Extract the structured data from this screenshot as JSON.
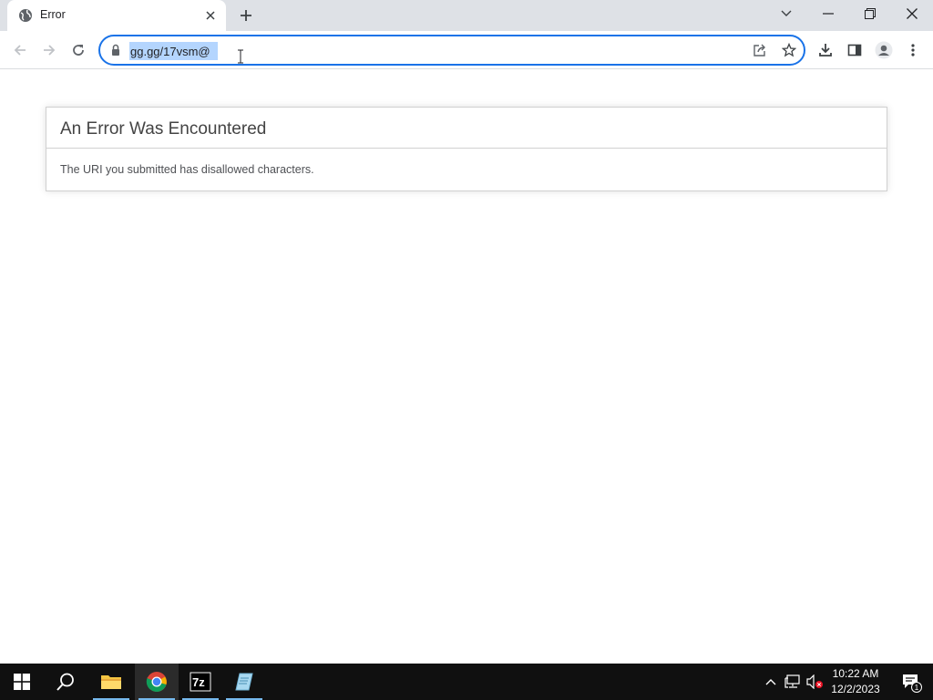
{
  "browser": {
    "tab": {
      "title": "Error",
      "favicon": "globe-icon"
    },
    "address_bar": {
      "url": "gg.gg/17vsm@"
    }
  },
  "page": {
    "error_title": "An Error Was Encountered",
    "error_message": "The URI you submitted has disallowed characters."
  },
  "taskbar": {
    "apps": [
      "start-icon",
      "search-icon",
      "file-explorer-icon",
      "chrome-icon",
      "7zip-icon",
      "notepad-icon"
    ],
    "app_7zip_label": "7z",
    "time": "10:22 AM",
    "date": "12/2/2023",
    "notification_count": "1"
  },
  "colors": {
    "accent": "#1a73e8",
    "selection": "#b4d5fe",
    "taskbar": "#101010",
    "tabstrip": "#dee1e6"
  }
}
